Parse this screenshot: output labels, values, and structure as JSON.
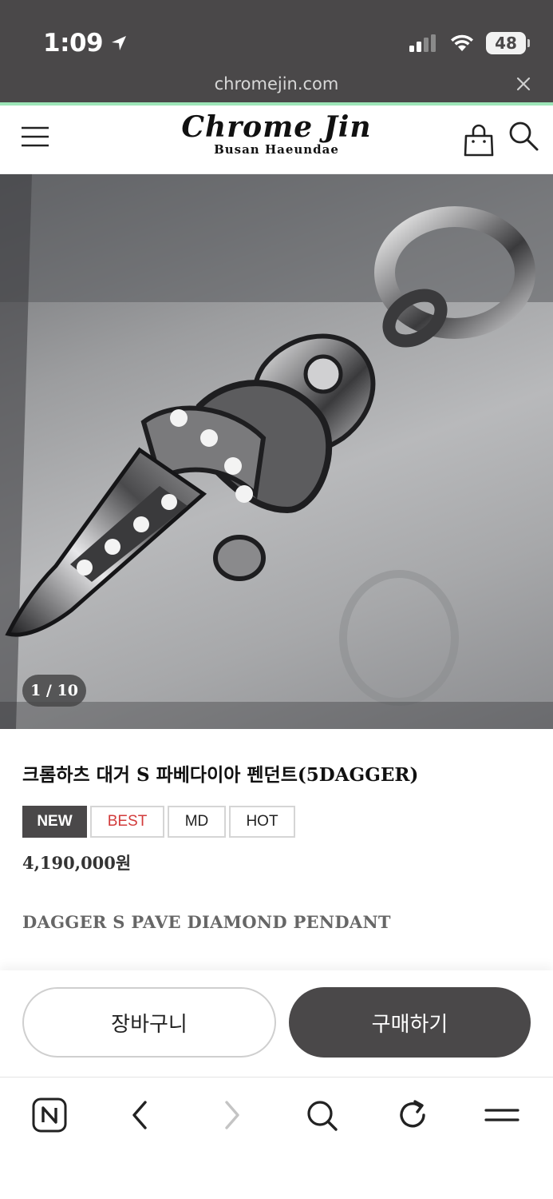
{
  "status_bar": {
    "time": "1:09",
    "battery": "48"
  },
  "browser": {
    "url": "chromejin.com"
  },
  "header": {
    "logo_main": "Chrome Jin",
    "logo_sub": "Busan Haeundae"
  },
  "gallery": {
    "counter": "1 / 10"
  },
  "product": {
    "title": "크롬하츠 대거 S 파베다이아 펜던트(5DAGGER)",
    "badges": [
      "NEW",
      "BEST",
      "MD",
      "HOT"
    ],
    "price": "4,190,000원",
    "subtitle": "DAGGER S PAVE DIAMOND PENDANT"
  },
  "actions": {
    "cart_label": "장바구니",
    "buy_label": "구매하기"
  },
  "icons": {
    "menu": "hamburger-menu-icon",
    "bag": "shopping-bag-icon",
    "search": "search-icon",
    "location": "location-arrow-icon",
    "signal": "cellular-signal-icon",
    "wifi": "wifi-icon",
    "battery": "battery-icon",
    "close": "close-icon",
    "naver": "naver-n-icon",
    "back": "chevron-left-icon",
    "forward": "chevron-right-icon",
    "reload": "reload-icon",
    "more": "more-menu-icon"
  },
  "colors": {
    "dark": "#4a4849",
    "best_red": "#d23b3b",
    "loadbar": "#9de6b8"
  }
}
